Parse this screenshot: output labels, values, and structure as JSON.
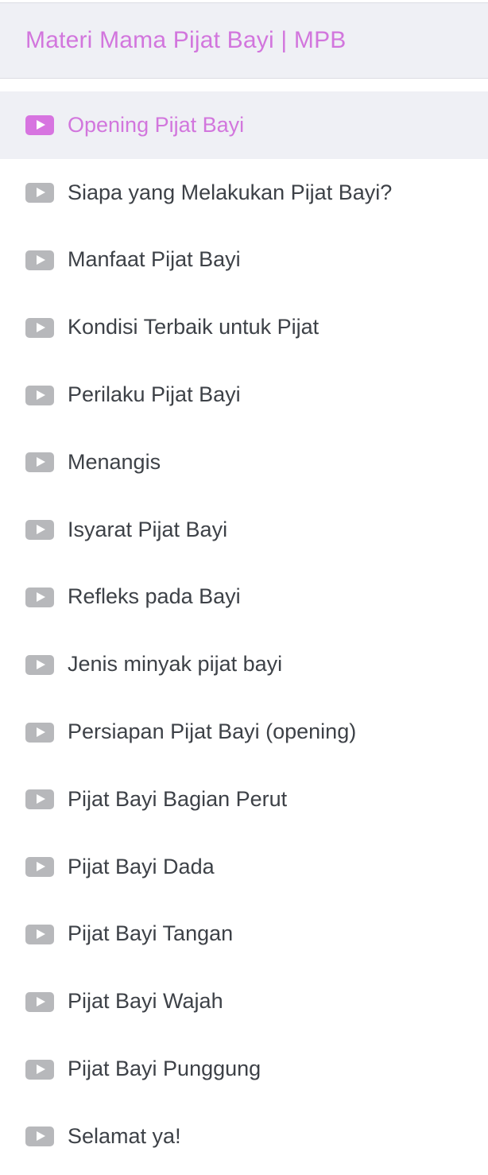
{
  "header": {
    "title": "Materi Mama Pijat Bayi | MPB"
  },
  "lessons": [
    {
      "label": "Opening Pijat Bayi",
      "active": true
    },
    {
      "label": "Siapa yang Melakukan Pijat Bayi?",
      "active": false
    },
    {
      "label": "Manfaat Pijat Bayi",
      "active": false
    },
    {
      "label": "Kondisi Terbaik untuk Pijat",
      "active": false
    },
    {
      "label": "Perilaku Pijat Bayi",
      "active": false
    },
    {
      "label": "Menangis",
      "active": false
    },
    {
      "label": "Isyarat Pijat Bayi",
      "active": false
    },
    {
      "label": "Refleks pada Bayi",
      "active": false
    },
    {
      "label": "Jenis minyak pijat bayi",
      "active": false
    },
    {
      "label": "Persiapan Pijat Bayi (opening)",
      "active": false
    },
    {
      "label": "Pijat Bayi Bagian Perut",
      "active": false
    },
    {
      "label": "Pijat Bayi Dada",
      "active": false
    },
    {
      "label": "Pijat Bayi Tangan",
      "active": false
    },
    {
      "label": "Pijat Bayi Wajah",
      "active": false
    },
    {
      "label": "Pijat Bayi Punggung",
      "active": false
    },
    {
      "label": "Selamat ya!",
      "active": false
    }
  ],
  "icons": {
    "lesson": "play-video-icon"
  },
  "colors": {
    "accent": "#d276dd",
    "active_background": "#eff0f5",
    "inactive_icon": "#b7b8bb",
    "text": "#3d4147"
  }
}
